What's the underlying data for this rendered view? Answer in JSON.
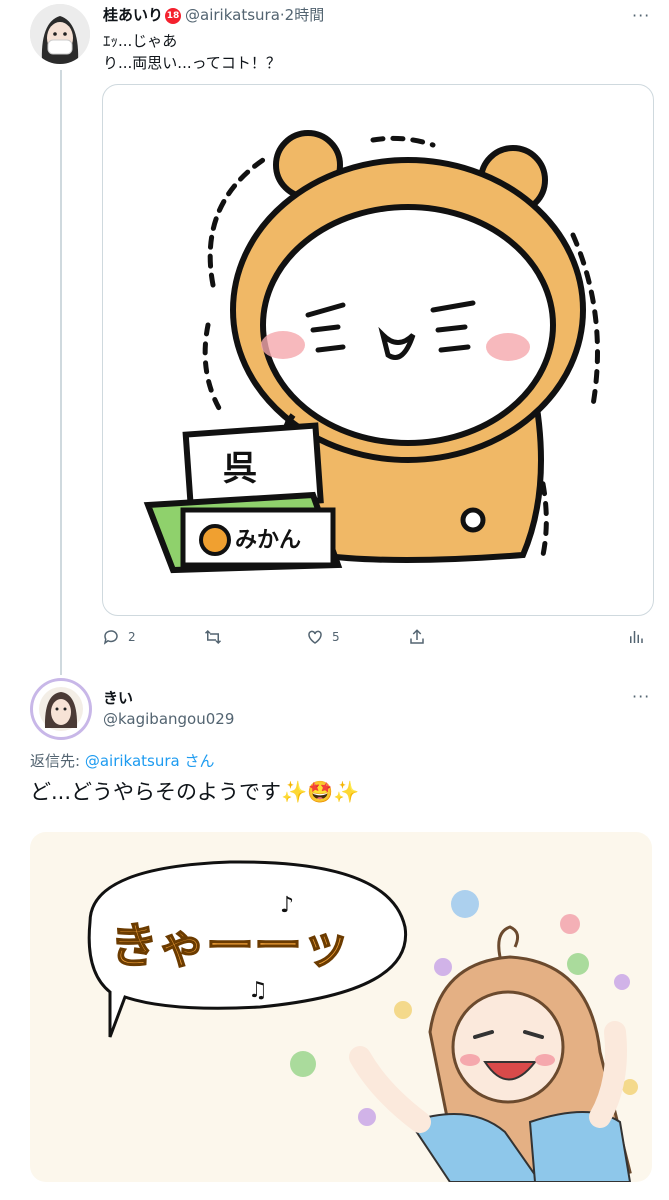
{
  "tweet1": {
    "display_name": "桂あいり",
    "badge": "18",
    "handle": "@airikatsura",
    "separator": "·",
    "time": "2時間",
    "more": "···",
    "text_line1": "ｴｯ...じゃあ",
    "text_line2": "り...両思い...ってコト！？",
    "image_labels": {
      "sign": "呉",
      "box": "みかん"
    },
    "replies": "2",
    "likes": "5"
  },
  "tweet2": {
    "display_name": "きい",
    "handle": "@kagibangou029",
    "more": "···",
    "reply_prefix": "返信先: ",
    "reply_to": "@airikatsura",
    "reply_suffix": " さん",
    "text": "ど...どうやらそのようです✨🤩✨",
    "image_label": "きゃーーッ"
  },
  "colors": {
    "accent": "#1d9bf0",
    "muted": "#536471",
    "bear": "#f0b866",
    "box_green": "#8fd16c"
  }
}
